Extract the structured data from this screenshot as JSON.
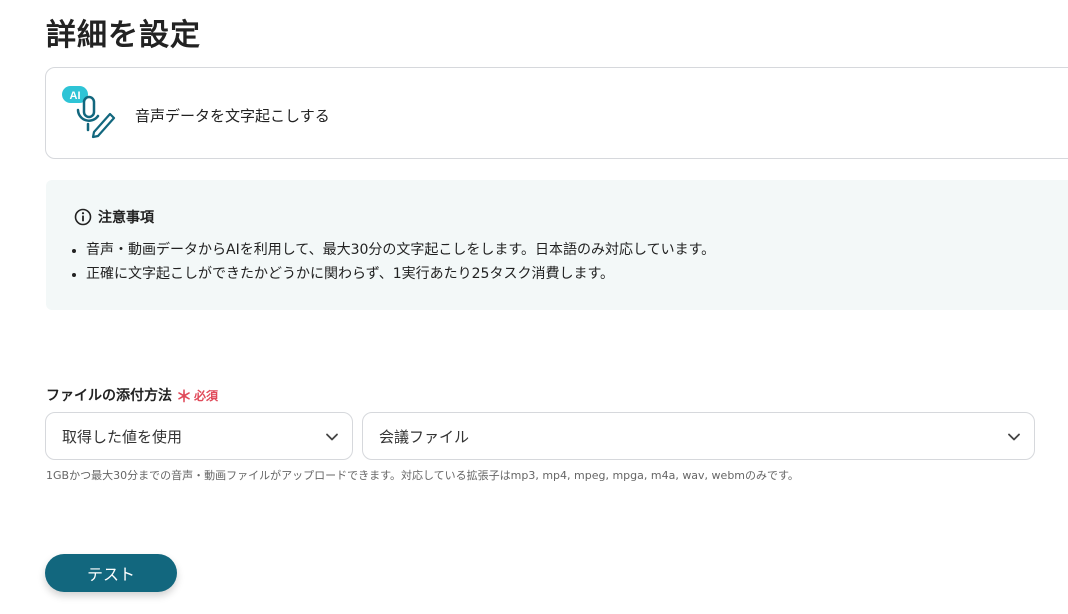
{
  "page": {
    "title": "詳細を設定"
  },
  "action": {
    "badge": "AI",
    "label": "音声データを文字起こしする",
    "icon": "microphone-pen-icon"
  },
  "notice": {
    "heading": "注意事項",
    "items": [
      "音声・動画データからAIを利用して、最大30分の文字起こしをします。日本語のみ対応しています。",
      "正確に文字起こしができたかどうかに関わらず、1実行あたり25タスク消費します。"
    ]
  },
  "field": {
    "label": "ファイルの添付方法",
    "required_mark": "＊",
    "required_text": "必須",
    "source_select": "取得した値を使用",
    "file_select": "会議ファイル",
    "help": "1GBかつ最大30分までの音声・動画ファイルがアップロードできます。対応している拡張子はmp3, mp4, mpeg, mpga, m4a, wav, webmのみです。"
  },
  "buttons": {
    "test": "テスト"
  },
  "colors": {
    "accent": "#12677e",
    "ai_badge": "#2ec4d6",
    "required": "#e04a5a",
    "notice_bg": "#f3f8f8"
  }
}
